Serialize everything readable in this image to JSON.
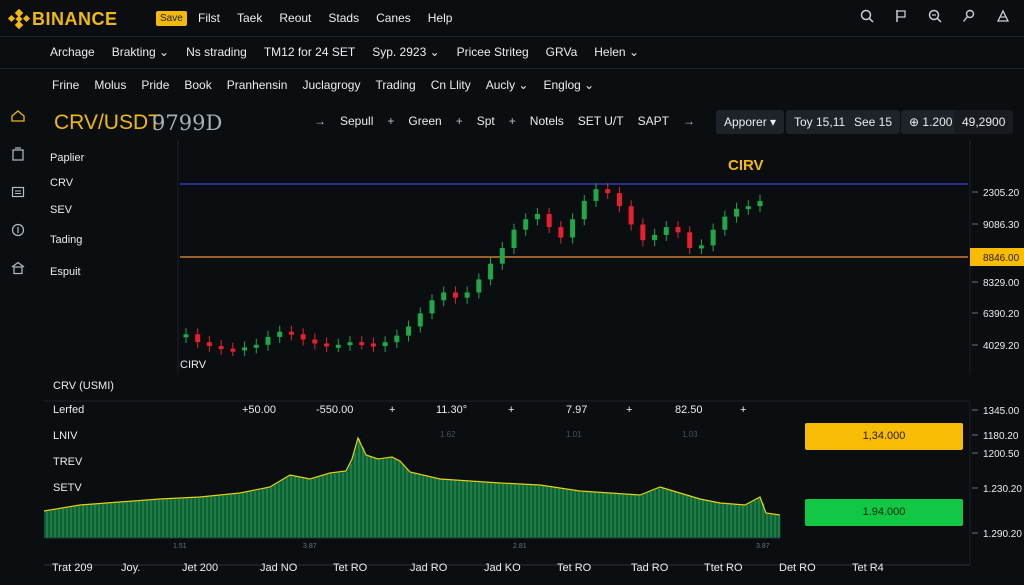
{
  "brand": {
    "name": "BINANCE",
    "color": "#f0b90b"
  },
  "topbar": {
    "save_label": "Save",
    "menu": [
      "Filst",
      "Taek",
      "Reout",
      "Stads",
      "Canes",
      "Help"
    ],
    "icons": [
      "search-icon",
      "flag-icon",
      "zoom-icon",
      "pin-icon",
      "settings-icon"
    ]
  },
  "nav1": {
    "items": [
      "Archage",
      "Brakting ⌄",
      "Ns strading",
      "TM12 for 24 SET",
      "Syp. 2923 ⌄",
      "Pricee Striteg",
      "GRVa",
      "Helen ⌄"
    ]
  },
  "nav2": {
    "items": [
      "Frine",
      "Molus",
      "Pride",
      "Book",
      "Pranhensin",
      "Juclagrogy",
      "Trading",
      "Cn Llity",
      "Aucly ⌄",
      "Englog ⌄"
    ]
  },
  "rail": {
    "icons": [
      "home-icon",
      "wallet-icon",
      "orders-icon",
      "coin-icon",
      "market-icon"
    ]
  },
  "pair": {
    "name": "CRV/USDT",
    "price": "9799D",
    "actions": [
      "→",
      "Sepull",
      "+",
      "Green",
      "+",
      "Spt",
      "+",
      "Notels",
      "SET U/T",
      "SAPT",
      "→"
    ],
    "dropdown": "Apporer ▾",
    "pill1": "Toy 15,11",
    "pill2": "See 15",
    "pill3": "⊕ 1.200",
    "pill4": "49,2900"
  },
  "side_labels": [
    "Paplier",
    "CRV",
    "SEV",
    "Tading",
    "Espuit"
  ],
  "main_chart": {
    "overlay_title": "CIRV",
    "bottom_label": "CIRV",
    "y_ticks": [
      "2305.20",
      "9086.30",
      "8329.00",
      "6390.20",
      "4029.20"
    ],
    "price_tag": "8846.00",
    "colors": {
      "up": "#1fa847",
      "down": "#e8202c",
      "hline_top": "#3a46d6",
      "hline_mid": "#f2903a"
    }
  },
  "sub_panel": {
    "title": "CRV (USMI)",
    "header_label": "Lerfed",
    "header_values": [
      "+50.00",
      "-550.00",
      "+",
      "11.30°",
      "+",
      "7.97",
      "+",
      "82.50",
      "+"
    ],
    "faint_labels": [
      "1.62",
      "1.01",
      "1.03"
    ],
    "rows": [
      "LNIV",
      "TREV",
      "SETV"
    ],
    "y_ticks": [
      "1345.00",
      "1180.20",
      "1200.50",
      "1.230.20",
      "1.290.20"
    ],
    "yellow_value": "1,34.000",
    "green_value": "1.94.000",
    "bottom_faint": [
      "1.51",
      "3.87",
      "2.81",
      "3.87"
    ]
  },
  "xaxis": [
    "Trat 209",
    "Joy.",
    "Jet 200",
    "Jad NO",
    "Tet RO",
    "Jad RO",
    "Jad KO",
    "Tet RO",
    "Tad RO",
    "Ttet RO",
    "Det RO",
    "Tet R4"
  ],
  "chart_data": {
    "type": "line",
    "title": "CIRV",
    "xlabel": "",
    "ylabel": "",
    "x": [
      1,
      2,
      3,
      4,
      5,
      6,
      7,
      8,
      9,
      10,
      11,
      12,
      13,
      14,
      15,
      16,
      17,
      18,
      19,
      20,
      21,
      22,
      23,
      24,
      25,
      26,
      27,
      28,
      29,
      30,
      31,
      32,
      33,
      34,
      35,
      36,
      37,
      38,
      39,
      40,
      41,
      42,
      43,
      44,
      45,
      46,
      47,
      48,
      49,
      50
    ],
    "series": [
      {
        "values": [
          4600,
          4300,
          4150,
          4050,
          4000,
          4100,
          4200,
          4500,
          4700,
          4600,
          4400,
          4250,
          4150,
          4200,
          4300,
          4250,
          4150,
          4300,
          4550,
          4900,
          5400,
          5900,
          6200,
          6000,
          6200,
          6700,
          7300,
          7900,
          8600,
          9000,
          9200,
          8700,
          8300,
          9000,
          9700,
          10150,
          10000,
          9500,
          8800,
          8200,
          8400,
          8700,
          8500,
          7900,
          8000,
          8600,
          9100,
          9400,
          9500,
          9700
        ]
      }
    ],
    "ylim": [
      4000,
      10500
    ]
  }
}
